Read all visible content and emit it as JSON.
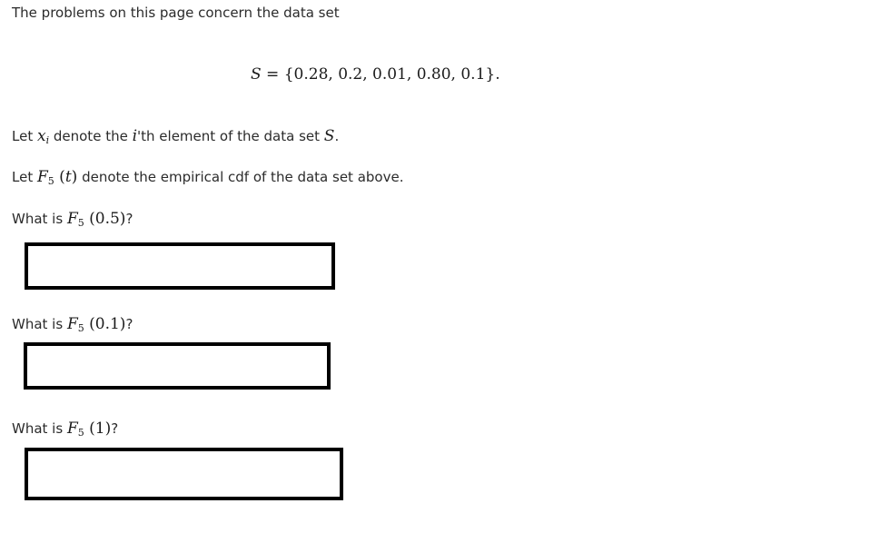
{
  "intro": {
    "text": "The problems on this page concern the data set"
  },
  "dataset": {
    "var": "S",
    "equals": " = ",
    "values": "{0.28, 0.2, 0.01, 0.80, 0.1}."
  },
  "definition_xi": {
    "prefix": "Let ",
    "var": "x",
    "sub": "i",
    "middle": " denote the ",
    "i_var": "i",
    "after_i": "'th element of the data set ",
    "set_var": "S",
    "end": "."
  },
  "definition_cdf": {
    "prefix": "Let ",
    "func": "F",
    "sub": "5",
    "arg_open": " (",
    "arg": "t",
    "arg_close": ")",
    "suffix": " denote the empirical cdf of the data set above."
  },
  "questions": [
    {
      "prefix": "What is ",
      "func": "F",
      "sub": "5",
      "arg": " (0.5)",
      "suffix": "?",
      "answer": ""
    },
    {
      "prefix": "What is ",
      "func": "F",
      "sub": "5",
      "arg": " (0.1)",
      "suffix": "?",
      "answer": ""
    },
    {
      "prefix": "What is ",
      "func": "F",
      "sub": "5",
      "arg": " (1)",
      "suffix": "?",
      "answer": ""
    }
  ]
}
